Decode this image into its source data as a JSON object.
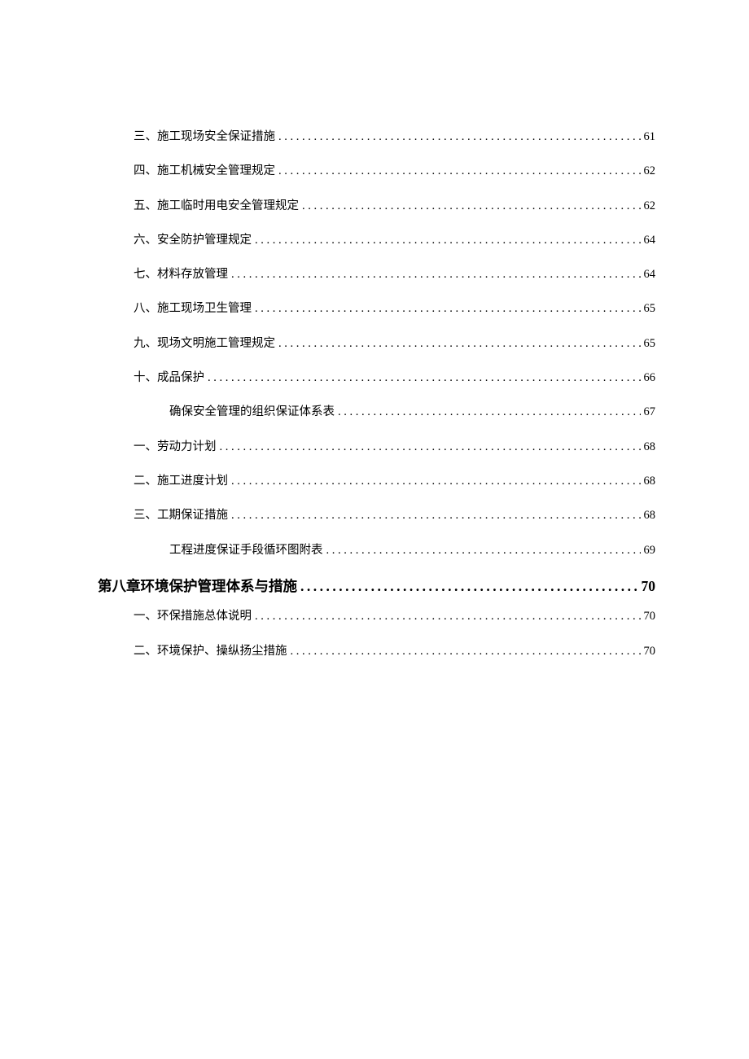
{
  "toc": {
    "entries": [
      {
        "level": 2,
        "label": "三、施工现场安全保证措施",
        "page": "61"
      },
      {
        "level": 2,
        "label": "四、施工机械安全管理规定",
        "page": "62"
      },
      {
        "level": 2,
        "label": "五、施工临时用电安全管理规定",
        "page": "62"
      },
      {
        "level": 2,
        "label": "六、安全防护管理规定",
        "page": "64"
      },
      {
        "level": 2,
        "label": "七、材料存放管理",
        "page": "64"
      },
      {
        "level": 2,
        "label": "八、施工现场卫生管理",
        "page": "65"
      },
      {
        "level": 2,
        "label": "九、现场文明施工管理规定",
        "page": "65"
      },
      {
        "level": 2,
        "label": "十、成品保护",
        "page": "66"
      },
      {
        "level": 3,
        "label": "确保安全管理的组织保证体系表",
        "page": "67"
      },
      {
        "level": 2,
        "label": "一、劳动力计划",
        "page": "68"
      },
      {
        "level": 2,
        "label": "二、施工进度计划",
        "page": "68"
      },
      {
        "level": 2,
        "label": "三、工期保证措施",
        "page": "68"
      },
      {
        "level": 3,
        "label": "工程进度保证手段循环图附表",
        "page": "69"
      },
      {
        "level": 1,
        "label": "第八章环境保护管理体系与措施",
        "page": "70"
      },
      {
        "level": 2,
        "label": "一、环保措施总体说明",
        "page": "70"
      },
      {
        "level": 2,
        "label": "二、环境保护、操纵扬尘措施",
        "page": "70"
      }
    ]
  }
}
